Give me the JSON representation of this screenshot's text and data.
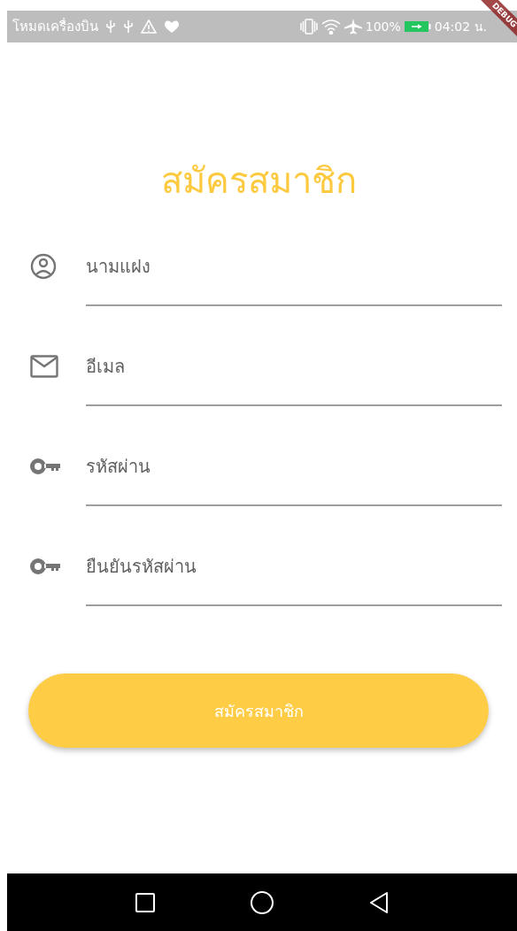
{
  "status_bar": {
    "mode_text": "โหมดเครื่องบิน",
    "battery_percent": "100%",
    "time": "04:02 น."
  },
  "debug_banner": "DEBUG",
  "title": "สมัครสมาชิก",
  "fields": [
    {
      "kind": "person",
      "placeholder": "นามแฝง"
    },
    {
      "kind": "mail",
      "placeholder": "อีเมล"
    },
    {
      "kind": "key",
      "placeholder": "รหัสผ่าน"
    },
    {
      "kind": "key",
      "placeholder": "ยืนยันรหัสผ่าน"
    }
  ],
  "submit_button": "สมัครสมาชิก"
}
